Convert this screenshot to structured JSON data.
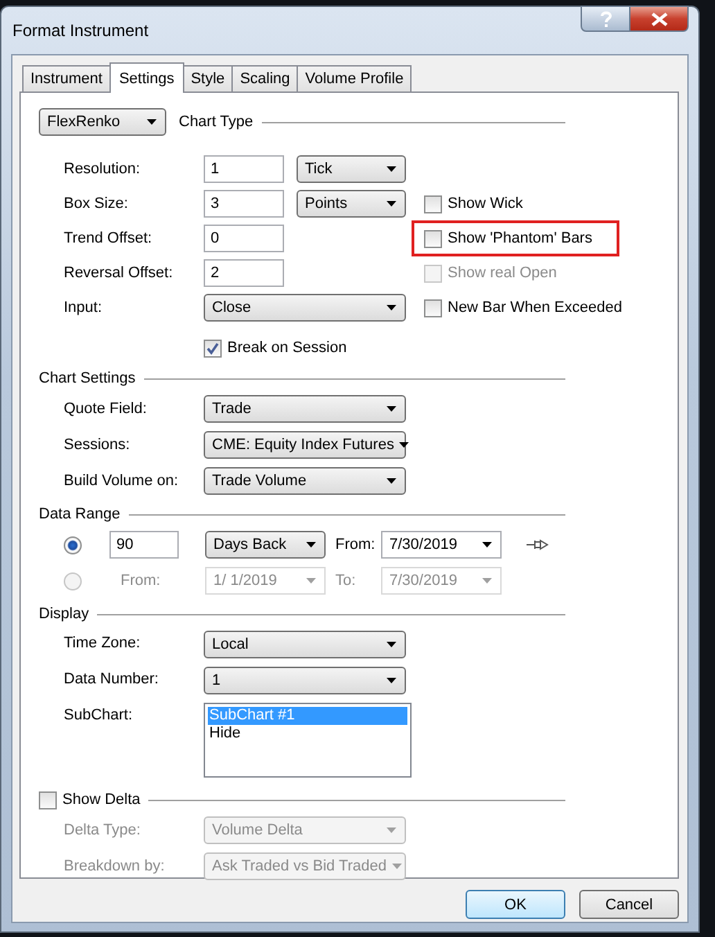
{
  "window": {
    "title": "Format Instrument"
  },
  "tabs": [
    {
      "label": "Instrument",
      "selected": false
    },
    {
      "label": "Settings",
      "selected": true
    },
    {
      "label": "Style",
      "selected": false
    },
    {
      "label": "Scaling",
      "selected": false
    },
    {
      "label": "Volume Profile",
      "selected": false
    }
  ],
  "chart_type": {
    "selector": "FlexRenko",
    "title": "Chart Type",
    "rows": [
      {
        "label": "Resolution:",
        "value": "1",
        "unit": "Tick"
      },
      {
        "label": "Box Size:",
        "value": "3",
        "unit": "Points",
        "option": {
          "label": "Show Wick",
          "checked": false,
          "disabled": false,
          "highlighted": false
        }
      },
      {
        "label": "Trend Offset:",
        "value": "0",
        "option": {
          "label": "Show 'Phantom' Bars",
          "checked": false,
          "disabled": false,
          "highlighted": true
        }
      },
      {
        "label": "Reversal Offset:",
        "value": "2",
        "option": {
          "label": "Show real Open",
          "checked": false,
          "disabled": true,
          "highlighted": false
        }
      },
      {
        "label": "Input:",
        "dropdown": "Close",
        "option": {
          "label": "New Bar When Exceeded",
          "checked": false,
          "disabled": false,
          "highlighted": false
        }
      }
    ],
    "break_on_session": {
      "label": "Break on Session",
      "checked": true
    }
  },
  "chart_settings": {
    "title": "Chart Settings",
    "rows": [
      {
        "label": "Quote Field:",
        "dropdown": "Trade"
      },
      {
        "label": "Sessions:",
        "dropdown": "CME: Equity Index Futures"
      },
      {
        "label": "Build Volume on:",
        "dropdown": "Trade Volume"
      }
    ]
  },
  "data_range": {
    "title": "Data Range",
    "rows": [
      {
        "kind": "days",
        "selected": true,
        "disabled": false,
        "days": "90",
        "period": "Days Back",
        "from_label": "From:",
        "from": "7/30/2019"
      },
      {
        "kind": "range",
        "selected": false,
        "disabled": true,
        "from_label": "From:",
        "from": "1/  1/2019",
        "to_label": "To:",
        "to": "7/30/2019"
      }
    ]
  },
  "display": {
    "title": "Display",
    "rows": [
      {
        "label": "Time Zone:",
        "dropdown": "Local"
      },
      {
        "label": "Data Number:",
        "dropdown": "1"
      },
      {
        "label": "SubChart:",
        "list": [
          {
            "label": "SubChart #1",
            "selected": true
          },
          {
            "label": "Hide",
            "selected": false
          }
        ]
      }
    ]
  },
  "delta": {
    "label": "Show Delta",
    "checked": false,
    "rows": [
      {
        "label": "Delta Type:",
        "dropdown": "Volume Delta",
        "disabled": true
      },
      {
        "label": "Breakdown by:",
        "dropdown": "Ask Traded vs Bid Traded",
        "disabled": true
      }
    ]
  },
  "buttons": [
    {
      "label": "OK",
      "default": true
    },
    {
      "label": "Cancel",
      "default": false
    }
  ]
}
